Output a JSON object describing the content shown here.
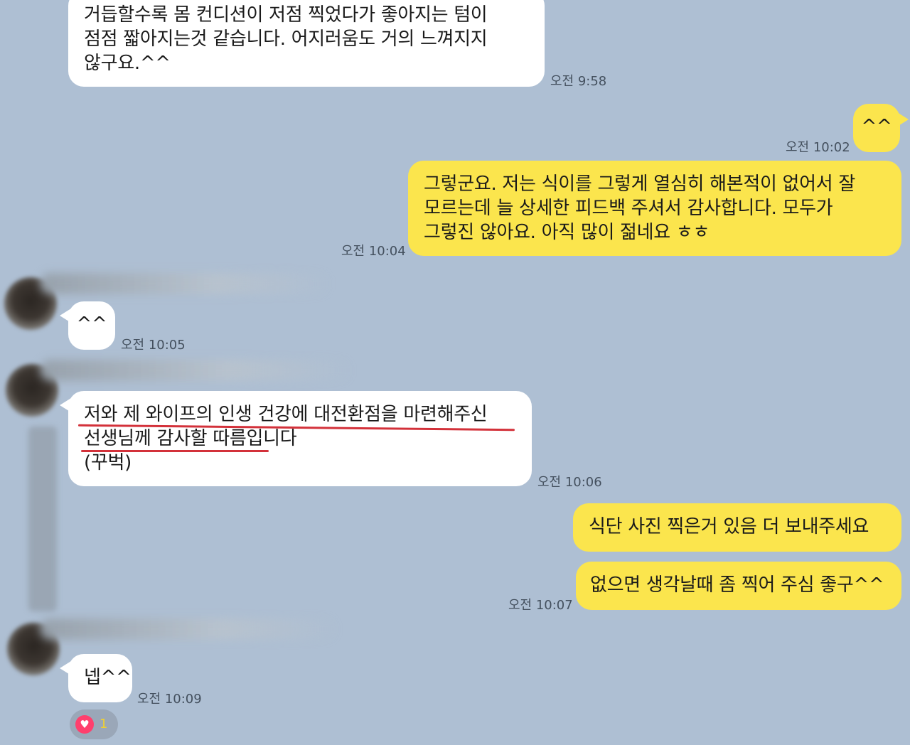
{
  "messages": [
    {
      "id": "m1",
      "direction": "incoming",
      "lines": [
        "거듭할수록 몸 컨디션이 저점 찍었다가 좋아지는 텀이",
        "점점 짧아지는것 같습니다. 어지러움도 거의 느껴지지",
        "않구요.^^"
      ],
      "time": "오전 9:58"
    },
    {
      "id": "m2",
      "direction": "outgoing",
      "lines": [
        "^^"
      ],
      "time": "오전 10:02"
    },
    {
      "id": "m3",
      "direction": "outgoing",
      "lines": [
        "그렇군요. 저는 식이를 그렇게 열심히 해본적이 없어서 잘",
        "모르는데 늘 상세한 피드백 주셔서 감사합니다. 모두가",
        "그렇진 않아요. 아직 많이 젊네요 ㅎㅎ"
      ],
      "time": "오전 10:04"
    },
    {
      "id": "m4",
      "direction": "incoming",
      "lines": [
        "^^"
      ],
      "time": "오전 10:05"
    },
    {
      "id": "m5",
      "direction": "incoming",
      "lines": [
        "저와 제 와이프의 인생 건강에 대전환점을 마련해주신",
        "선생님께 감사할 따름입니다",
        " (꾸벅)"
      ],
      "time": "오전 10:06"
    },
    {
      "id": "m6",
      "direction": "outgoing",
      "lines": [
        "식단 사진 찍은거 있음 더 보내주세요"
      ],
      "time": ""
    },
    {
      "id": "m7",
      "direction": "outgoing",
      "lines": [
        "없으면 생각날때 좀 찍어 주심 좋구^^"
      ],
      "time": "오전 10:07"
    },
    {
      "id": "m8",
      "direction": "incoming",
      "lines": [
        "넵^^"
      ],
      "time": "오전 10:09"
    }
  ],
  "reaction": {
    "icon": "heart-icon",
    "symbol": "♥",
    "count": "1"
  },
  "colors": {
    "background": "#aebfd3",
    "incoming_bubble": "#ffffff",
    "outgoing_bubble": "#fbe54d",
    "underline": "#d3313a",
    "reaction_heart": "#ff3f6d"
  }
}
